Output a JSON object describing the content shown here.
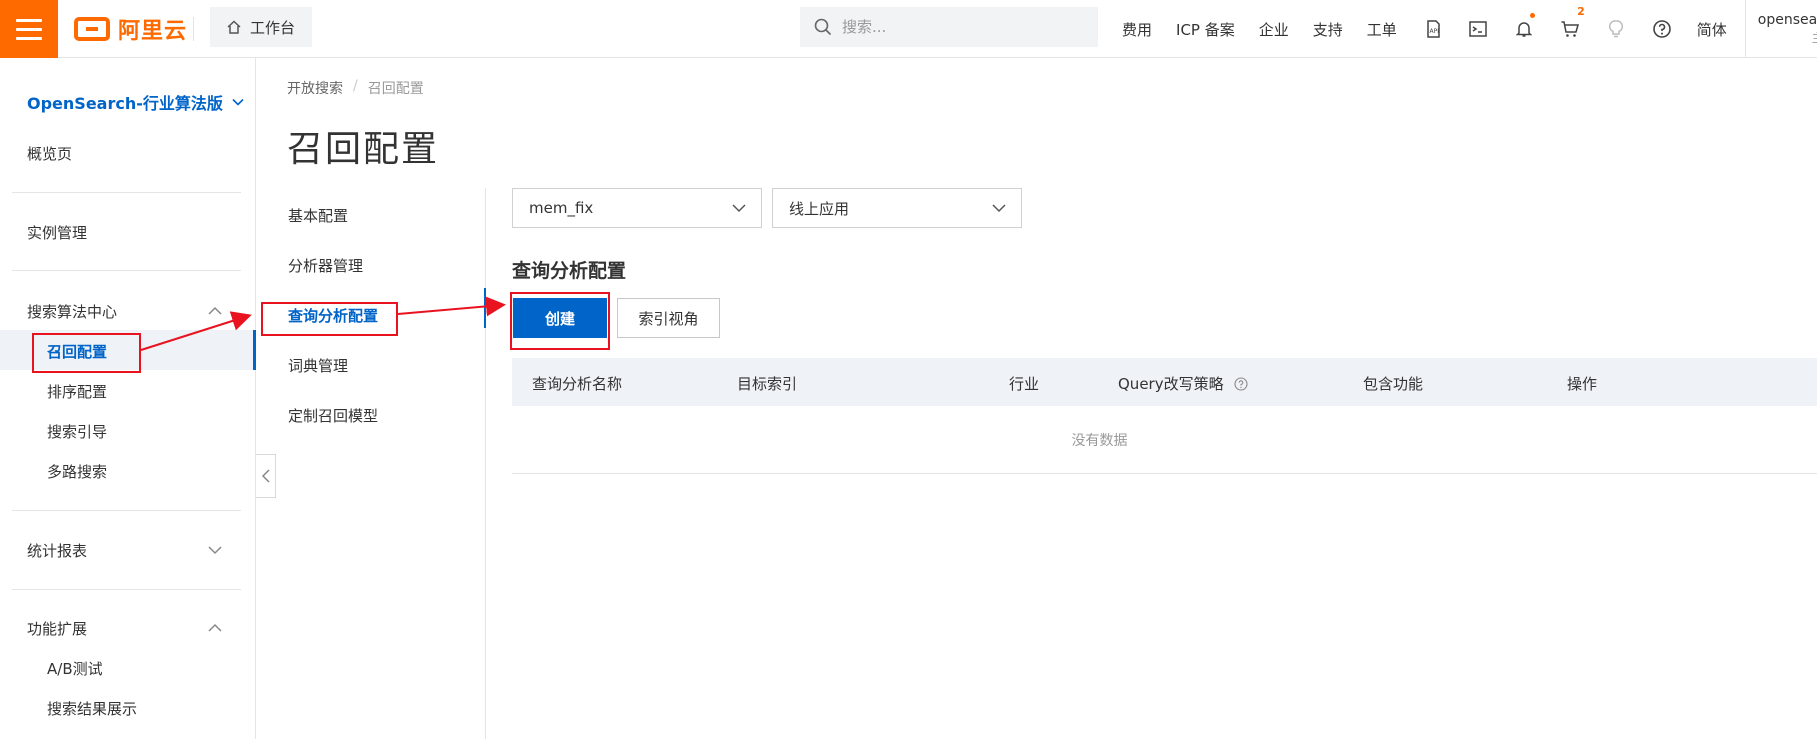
{
  "topbar": {
    "logo_text": "阿里云",
    "workbench_label": "工作台",
    "search_placeholder": "搜索...",
    "nav_links": [
      "费用",
      "ICP 备案",
      "企业",
      "支持",
      "工单"
    ],
    "cart_count": "2",
    "language_label": "简体",
    "account_name": "opensea",
    "account_sub": "主"
  },
  "sidebar": {
    "product_title": "OpenSearch-行业算法版",
    "overview": "概览页",
    "instance_management": "实例管理",
    "search_algo_center": "搜索算法中心",
    "search_algo_items": [
      "召回配置",
      "排序配置",
      "搜索引导",
      "多路搜索"
    ],
    "stats_report": "统计报表",
    "feature_ext": "功能扩展",
    "feature_ext_items": [
      "A/B测试",
      "搜索结果展示"
    ]
  },
  "breadcrumb": {
    "parent": "开放搜索",
    "separator": "/",
    "current": "召回配置"
  },
  "page_title": "召回配置",
  "subnav": {
    "items": [
      "基本配置",
      "分析器管理",
      "查询分析配置",
      "词典管理",
      "定制召回模型"
    ],
    "active_index": 2
  },
  "filters": {
    "app_select_value": "mem_fix",
    "env_select_value": "线上应用"
  },
  "section": {
    "title": "查询分析配置",
    "create_button": "创建",
    "index_view_button": "索引视角"
  },
  "table": {
    "columns": [
      "查询分析名称",
      "目标索引",
      "行业",
      "Query改写策略",
      "包含功能",
      "操作"
    ],
    "empty_text": "没有数据"
  },
  "colors": {
    "brand_orange": "#ff6a00",
    "primary_blue": "#0064c8",
    "annotation_red": "#e8131f"
  }
}
